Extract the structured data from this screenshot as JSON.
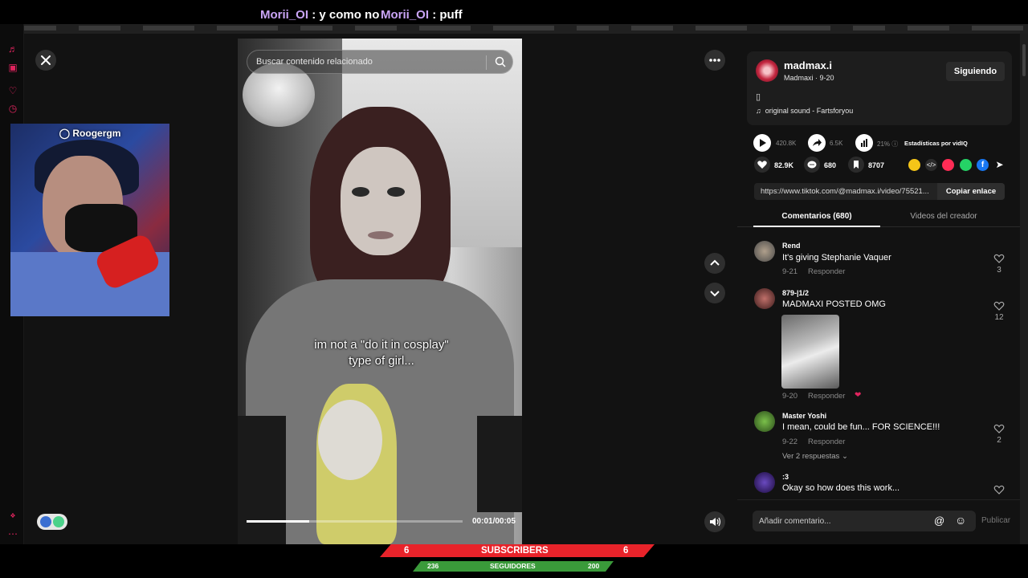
{
  "chat": {
    "messages": [
      {
        "user": "Morii_OI",
        "text": ": y como no"
      },
      {
        "user": "Morii_OI",
        "text": ": puff"
      }
    ]
  },
  "video": {
    "search_placeholder": "Buscar contenido relacionado",
    "caption_line1": "im not a \"do it in cosplay\"",
    "caption_line2": "type of girl...",
    "time": "00:01/00:05",
    "progress": 0.29
  },
  "webcam": {
    "name": "Roogergm"
  },
  "creator": {
    "username": "madmax.i",
    "subtitle": "Madmaxi · 9-20",
    "follow_label": "Siguiendo",
    "description": "▯",
    "sound": "original sound - Fartsforyou"
  },
  "stats": {
    "plays": "420.8K",
    "shares": "6.5K",
    "retention": "21%",
    "stats_label": "Estadísticas por vidIQ",
    "likes": "82.9K",
    "comments": "680",
    "saves": "8707"
  },
  "link": {
    "url": "https://www.tiktok.com/@madmax.i/video/75521...",
    "copy_label": "Copiar enlace"
  },
  "tabs": {
    "comments": "Comentarios (680)",
    "creator_videos": "Videos del creador"
  },
  "comments": [
    {
      "user": "Rend",
      "text": "It's giving Stephanie Vaquer",
      "date": "9-21",
      "reply": "Responder",
      "likes": "3"
    },
    {
      "user": "879-|1/2",
      "text": "MADMAXI POSTED OMG",
      "date": "9-20",
      "reply": "Responder",
      "likes": "12"
    },
    {
      "user": "Master Yoshi",
      "text": "I mean, could be fun... FOR SCIENCE!!!",
      "date": "9-22",
      "reply": "Responder",
      "likes": "2"
    },
    {
      "user": ":3",
      "text": "Okay so how does this work...",
      "date": "",
      "reply": "",
      "likes": ""
    }
  ],
  "view_replies": "Ver 2 respuestas",
  "comment_box": {
    "placeholder": "Añadir comentario...",
    "publish": "Publicar"
  },
  "counters": {
    "subscribers_left": "6",
    "subscribers_label": "SUBSCRIBERS",
    "subscribers_right": "6",
    "followers_left": "236",
    "followers_label": "SEGUIDORES",
    "followers_right": "200"
  },
  "colors": {
    "accent_red": "#e8232a",
    "follower_green": "#3a9a3a",
    "chat_user": "#c9a4f5",
    "sidebar_icon": "#e0245e"
  }
}
